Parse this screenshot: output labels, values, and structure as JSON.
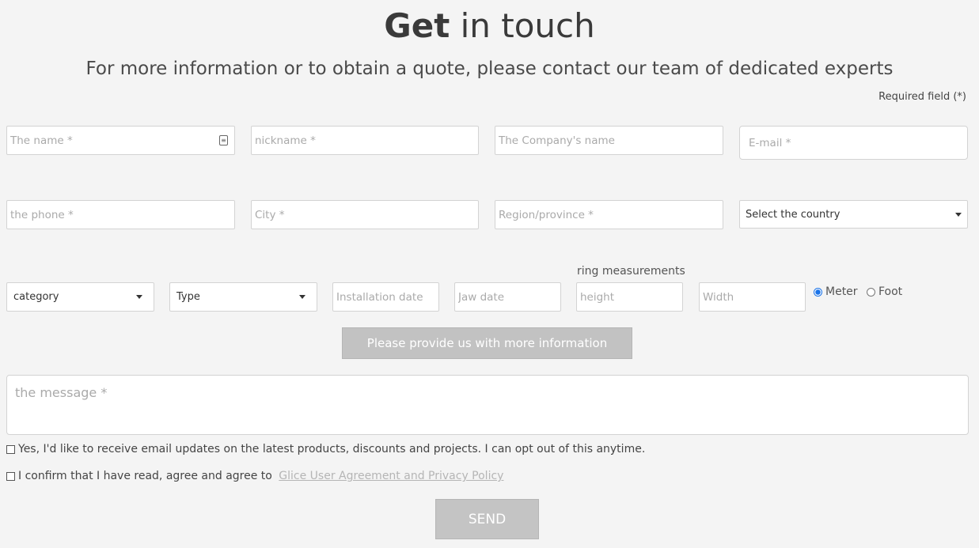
{
  "header": {
    "title_bold": "Get",
    "title_rest": " in touch",
    "subtitle": "For more information or to obtain a quote, please contact our team of dedicated experts",
    "required_note": "Required field (*)"
  },
  "row1": {
    "name_placeholder": "The name *",
    "nickname_placeholder": "nickname *",
    "company_placeholder": "The Company's name",
    "email_placeholder": "E-mail *"
  },
  "row2": {
    "phone_placeholder": "the phone *",
    "city_placeholder": "City *",
    "region_placeholder": "Region/province *",
    "country_select": "Select the country"
  },
  "row3": {
    "category_select": "category",
    "type_select": "Type",
    "installation_date_placeholder": "Installation date",
    "jaw_date_placeholder": "Jaw date",
    "ring_label": "ring measurements",
    "height_placeholder": "height",
    "width_placeholder": "Width",
    "unit_options": [
      {
        "label": "Meter",
        "selected": true
      },
      {
        "label": "Foot",
        "selected": false
      }
    ]
  },
  "more_info_button": "Please provide us with more information",
  "message_placeholder": "the message *",
  "consent": {
    "newsletter": "Yes, I'd like to receive email updates on the latest products, discounts and projects. I can opt out of this anytime.",
    "agreement_text": "I confirm that I have read, agree and agree to ",
    "agreement_link": "Glice User Agreement and Privacy Policy"
  },
  "send_button": "SEND",
  "icons": {
    "contact_card": "contact-card-icon",
    "dropdown": "caret-down-icon"
  },
  "colors": {
    "background": "#f4f4f4",
    "button_gray": "#c2c2c2",
    "radio_selected": "#1a73e8",
    "link_gray": "#b5b5b5"
  }
}
